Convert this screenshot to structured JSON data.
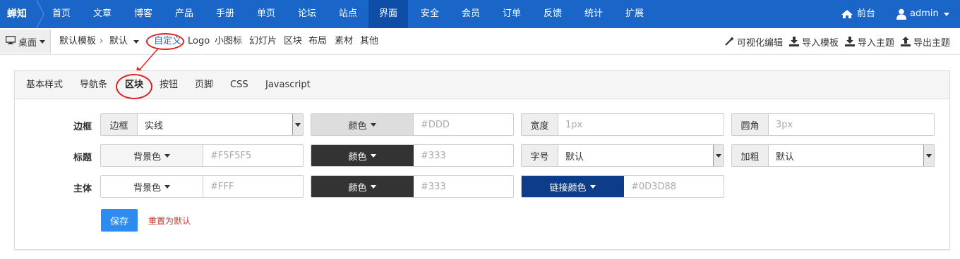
{
  "topnav": {
    "brand": "蝉知",
    "items": [
      {
        "label": "首页"
      },
      {
        "label": "文章"
      },
      {
        "label": "博客"
      },
      {
        "label": "产品"
      },
      {
        "label": "手册"
      },
      {
        "label": "单页"
      },
      {
        "label": "论坛"
      },
      {
        "label": "站点"
      },
      {
        "label": "界面"
      },
      {
        "label": "安全"
      },
      {
        "label": "会员"
      },
      {
        "label": "订单"
      },
      {
        "label": "反馈"
      },
      {
        "label": "统计"
      },
      {
        "label": "扩展"
      }
    ],
    "active": "界面",
    "frontend": "前台",
    "user": "admin",
    "icons": {
      "frontend": "home-icon",
      "user": "user-icon"
    }
  },
  "subnav": {
    "desktop": "桌面",
    "theme": "默认模板",
    "separator": "›",
    "variant": "默认",
    "links": [
      {
        "label": "自定义"
      },
      {
        "label": "Logo"
      },
      {
        "label": "小图标"
      },
      {
        "label": "幻灯片"
      },
      {
        "label": "区块"
      },
      {
        "label": "布局"
      },
      {
        "label": "素材"
      },
      {
        "label": "其他"
      }
    ],
    "current": "自定义",
    "actions": [
      {
        "label": "可视化编辑",
        "icon": "magic-wand-icon"
      },
      {
        "label": "导入模板",
        "icon": "download-icon"
      },
      {
        "label": "导入主题",
        "icon": "download-icon"
      },
      {
        "label": "导出主题",
        "icon": "upload-icon"
      }
    ]
  },
  "tabs": {
    "items": [
      {
        "label": "基本样式"
      },
      {
        "label": "导航条"
      },
      {
        "label": "区块"
      },
      {
        "label": "按钮"
      },
      {
        "label": "页脚"
      },
      {
        "label": "CSS"
      },
      {
        "label": "Javascript"
      }
    ],
    "active": "区块"
  },
  "form": {
    "border": {
      "label": "边框",
      "style": {
        "addon": "边框",
        "value": "实线"
      },
      "color": {
        "addon": "颜色",
        "placeholder": "#DDD"
      },
      "width": {
        "addon": "宽度",
        "placeholder": "1px"
      },
      "radius": {
        "addon": "圆角",
        "placeholder": "3px"
      }
    },
    "title": {
      "label": "标题",
      "bg": {
        "addon": "背景色",
        "placeholder": "#F5F5F5"
      },
      "color": {
        "addon": "颜色",
        "placeholder": "#333"
      },
      "fontsize": {
        "addon": "字号",
        "value": "默认"
      },
      "bold": {
        "addon": "加粗",
        "value": "默认"
      }
    },
    "body": {
      "label": "主体",
      "bg": {
        "addon": "背景色",
        "placeholder": "#FFF"
      },
      "color": {
        "addon": "颜色",
        "placeholder": "#333"
      },
      "link": {
        "addon": "链接颜色",
        "placeholder": "#0D3D88"
      }
    },
    "save": "保存",
    "reset": "重置为默认"
  },
  "colors": {
    "nav_bg": "#1a66c8",
    "nav_active": "#0e4ea6",
    "primary_button": "#2d8cf0",
    "dark_addon": "#333333",
    "link_addon": "#0d3d88",
    "highlight_ring": "#e02020",
    "reset_link": "#c0392b"
  }
}
